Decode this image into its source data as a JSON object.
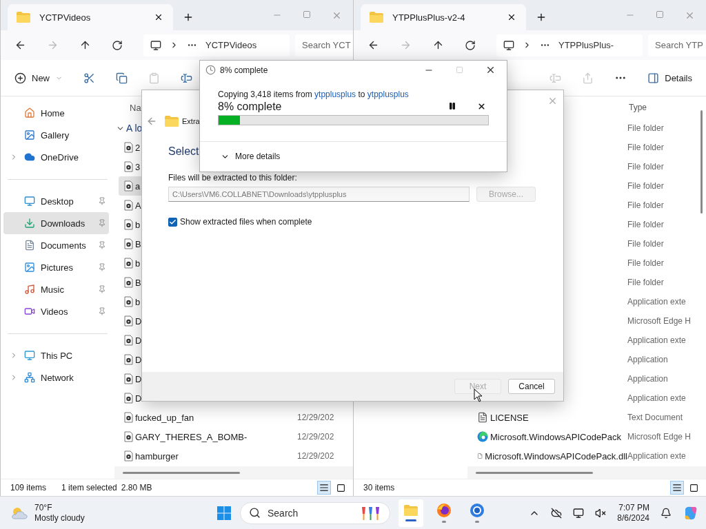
{
  "windows": [
    {
      "tab_title": "YCTPVideos",
      "address": "YCTPVideos",
      "search_placeholder": "Search YCT",
      "toolbar": {
        "new_label": "New"
      },
      "sidebar": [
        [
          {
            "label": "Home",
            "expandable": false,
            "pinned": false,
            "selected": false
          },
          {
            "label": "Gallery",
            "expandable": false,
            "pinned": false,
            "selected": false
          },
          {
            "label": "OneDrive",
            "expandable": true,
            "pinned": false,
            "selected": false
          }
        ],
        [
          {
            "label": "Desktop",
            "expandable": false,
            "pinned": true,
            "selected": false
          },
          {
            "label": "Downloads",
            "expandable": false,
            "pinned": true,
            "selected": true
          },
          {
            "label": "Documents",
            "expandable": false,
            "pinned": true,
            "selected": false
          },
          {
            "label": "Pictures",
            "expandable": false,
            "pinned": true,
            "selected": false
          },
          {
            "label": "Music",
            "expandable": false,
            "pinned": true,
            "selected": false
          },
          {
            "label": "Videos",
            "expandable": false,
            "pinned": true,
            "selected": false
          }
        ],
        [
          {
            "label": "This PC",
            "expandable": true,
            "pinned": false,
            "selected": false
          },
          {
            "label": "Network",
            "expandable": true,
            "pinned": false,
            "selected": false
          }
        ]
      ],
      "name_header": "Na",
      "group": "A lo",
      "rows": [
        {
          "name": "2",
          "kind": "video",
          "selected": false
        },
        {
          "name": "3",
          "kind": "video",
          "selected": false
        },
        {
          "name": "a",
          "kind": "video",
          "selected": true
        },
        {
          "name": "A",
          "kind": "video",
          "selected": false
        },
        {
          "name": "b",
          "kind": "video",
          "selected": false
        },
        {
          "name": "B",
          "kind": "video",
          "selected": false
        },
        {
          "name": "b",
          "kind": "video",
          "selected": false
        },
        {
          "name": "B",
          "kind": "video",
          "selected": false
        },
        {
          "name": "b",
          "kind": "video",
          "selected": false
        },
        {
          "name": "D",
          "kind": "video",
          "selected": false
        },
        {
          "name": "D",
          "kind": "video",
          "selected": false
        },
        {
          "name": "D",
          "kind": "video",
          "selected": false
        },
        {
          "name": "D",
          "kind": "video",
          "selected": false
        },
        {
          "name": "D",
          "kind": "video",
          "selected": false
        },
        {
          "name": "fucked_up_fan",
          "kind": "video",
          "date": "12/29/202",
          "selected": false
        },
        {
          "name": "GARY_THERES_A_BOMB-",
          "kind": "video",
          "date": "12/29/202",
          "selected": false
        },
        {
          "name": "hamburger",
          "kind": "video",
          "date": "12/29/202",
          "selected": false
        }
      ],
      "status": [
        "109 items",
        "1 item selected",
        "2.80 MB"
      ]
    },
    {
      "tab_title": "YTPPlusPlus-v2-4",
      "address": "YTPPlusPlus-",
      "search_placeholder": "Search YTP",
      "toolbar": {
        "details_label": "Details"
      },
      "type_header": "Type",
      "rows": [
        {
          "type": "File folder",
          "selected": false
        },
        {
          "type": "File folder",
          "selected": false
        },
        {
          "type": "File folder",
          "selected": false
        },
        {
          "type": "File folder",
          "selected": false
        },
        {
          "type": "File folder",
          "selected": false
        },
        {
          "type": "File folder",
          "selected": false
        },
        {
          "type": "File folder",
          "selected": false
        },
        {
          "type": "File folder",
          "selected": false
        },
        {
          "type": "File folder",
          "selected": false
        },
        {
          "type": "Application exte",
          "selected": false
        },
        {
          "type": "Microsoft Edge H",
          "selected": false
        },
        {
          "type": "Application exte",
          "selected": false
        },
        {
          "type": "Application",
          "selected": false
        },
        {
          "type": "Application",
          "selected": false
        },
        {
          "type": "Application exte",
          "selected": false
        },
        {
          "name": "LICENSE",
          "kind": "text",
          "type": "Text Document",
          "selected": false
        },
        {
          "name": "Microsoft.WindowsAPICodePack",
          "kind": "browser",
          "type": "Microsoft Edge H",
          "selected": false
        },
        {
          "name": "Microsoft.WindowsAPICodePack.dll",
          "kind": "library",
          "type": "Application exte",
          "selected": false
        }
      ],
      "status": [
        "30 items"
      ]
    }
  ],
  "extract_dialog": {
    "header": "Extra",
    "title": "Select",
    "field_label": "Files will be extracted to this folder:",
    "path": "C:\\Users\\VM6.COLLABNET\\Downloads\\ytpplusplus",
    "browse": {
      "label": "Browse...",
      "disabled": true
    },
    "show_files": {
      "label": "Show extracted files when complete",
      "checked": true
    },
    "buttons": [
      {
        "label": "Next",
        "disabled": true
      },
      {
        "label": "Cancel",
        "disabled": false
      }
    ]
  },
  "progress_dialog": {
    "title": "8% complete",
    "copy_prefix": "Copying 3,418 items from",
    "source": "ytpplusplus",
    "joiner": "to",
    "destination": "ytpplusplus",
    "status": "8% complete",
    "level": 0.08,
    "more_details": "More details"
  },
  "taskbar": {
    "temperature": "70°F",
    "condition": "Mostly cloudy",
    "search_label": "Search",
    "apps": [
      {
        "active": true
      },
      {
        "active": false
      },
      {
        "active": false
      }
    ],
    "time": "7:07 PM",
    "date": "8/6/2024"
  }
}
